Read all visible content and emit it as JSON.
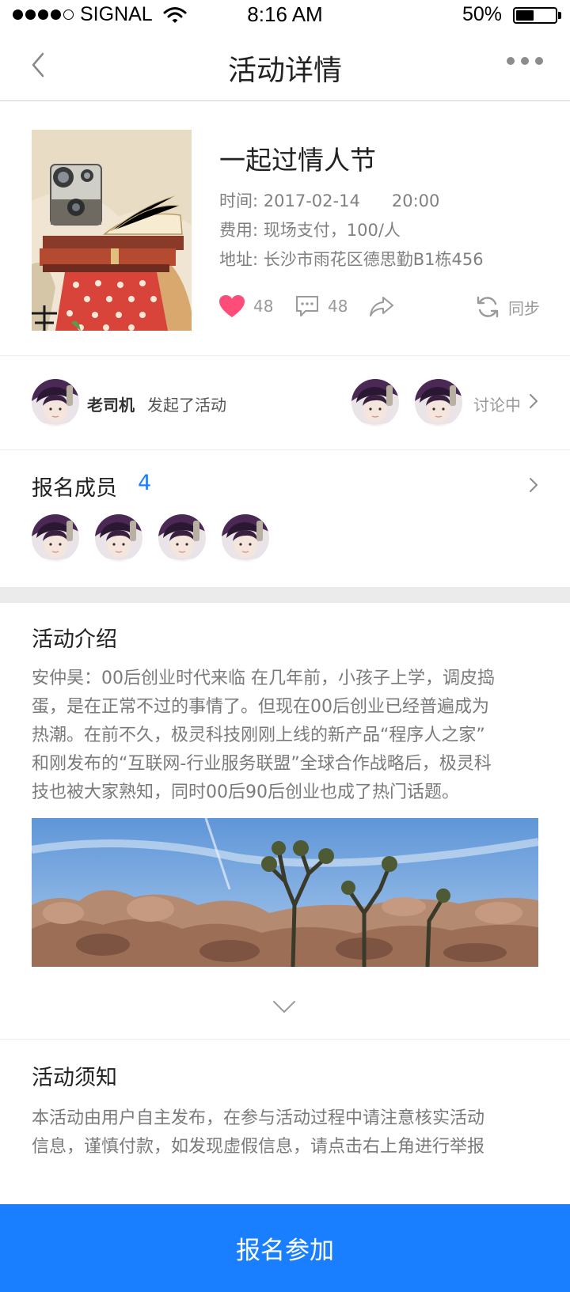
{
  "status_bar": {
    "carrier": "SIGNAL",
    "time": "8:16 AM",
    "battery": "50%",
    "battery_level": 0.5
  },
  "nav": {
    "title": "活动详情"
  },
  "event": {
    "title": "一起过情人节",
    "time_label": "时间:",
    "time_value": "2017-02-14      20:00",
    "fee_label": "费用:",
    "fee_value": "现场支付，100/人",
    "address_label": "地址:",
    "address_value": "长沙市雨花区德思勤B1栋456",
    "likes": "48",
    "comments": "48",
    "sync_label": "同步",
    "like_color": "#ff4d7a"
  },
  "initiator": {
    "name": "老司机",
    "action": "发起了活动",
    "status": "讨论中"
  },
  "members": {
    "title": "报名成员",
    "count": "4"
  },
  "intro": {
    "title": "活动介绍",
    "lines": [
      "安仲昊：00后创业时代来临 在几年前，小孩子上学，调皮捣",
      "蛋，是在正常不过的事情了。但现在00后创业已经普遍成为",
      "热潮。在前不久，极灵科技刚刚上线的新产品“程序人之家”",
      "和刚发布的“互联网-行业服务联盟”全球合作战略后，极灵科",
      "技也被大家熟知，同时00后90后创业也成了热门话题。"
    ]
  },
  "notice": {
    "title": "活动须知",
    "lines": [
      "本活动由用户自主发布，在参与活动过程中请注意核实活动",
      "信息，谨慎付款，如发现虚假信息，请点击右上角进行举报"
    ]
  },
  "join_button": {
    "label": "报名参加",
    "color": "#1a7fff"
  }
}
